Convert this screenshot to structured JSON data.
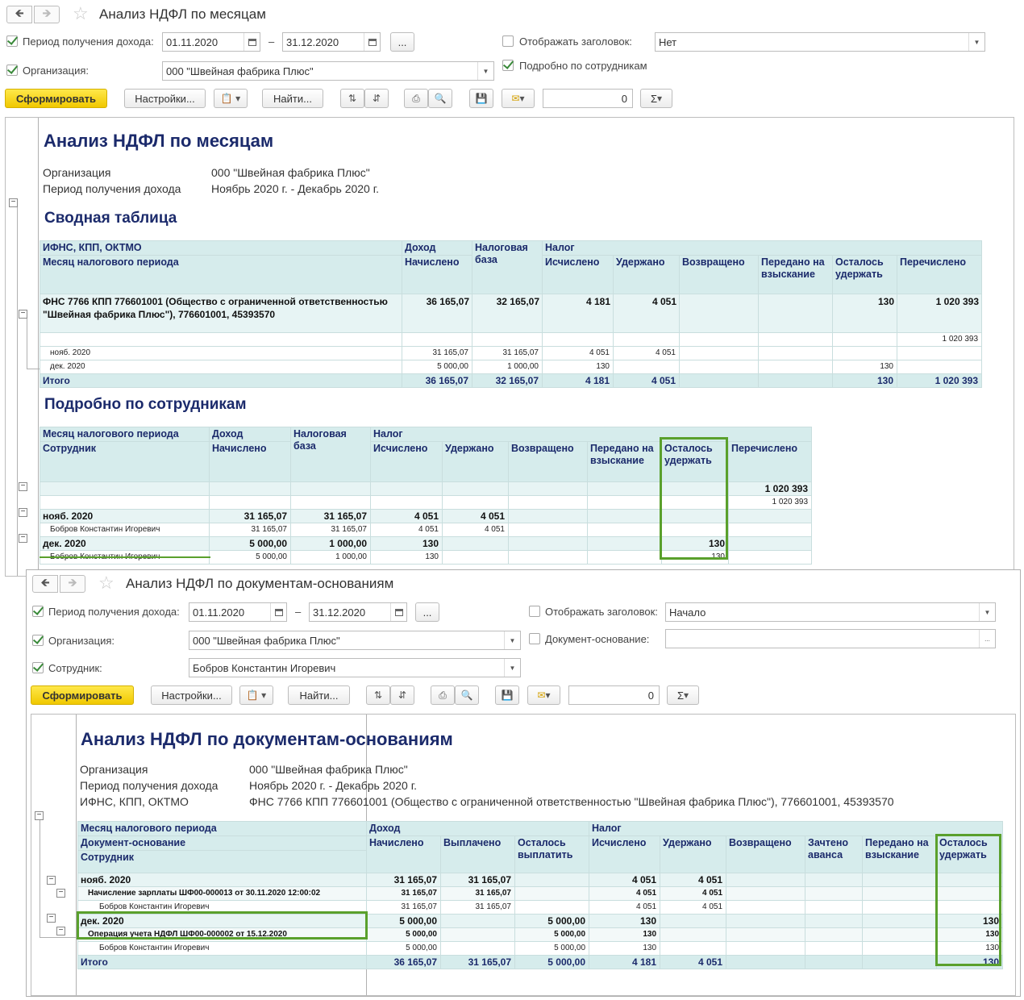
{
  "win1": {
    "title": "Анализ НДФЛ по месяцам",
    "period_label": "Период получения дохода:",
    "date_from": "01.11.2020",
    "date_sep": "–",
    "date_to": "31.12.2020",
    "dots": "...",
    "org_label": "Организация:",
    "org_value": "000 \"Швейная фабрика Плюс\"",
    "show_header_label": "Отображать заголовок:",
    "show_header_value": "Нет",
    "detail_label": "Подробно по сотрудникам",
    "btn_generate": "Сформировать",
    "btn_settings": "Настройки...",
    "btn_find": "Найти...",
    "sum_value": "0",
    "sigma": "Σ",
    "report": {
      "title": "Анализ НДФЛ по месяцам",
      "org_label": "Организация",
      "org_value": "000 \"Швейная фабрика Плюс\"",
      "period_label": "Период получения дохода",
      "period_value": "Ноябрь 2020 г. - Декабрь 2020 г.",
      "summary_title": "Сводная таблица",
      "detail_title": "Подробно по сотрудникам",
      "t1": {
        "h_ifns": "ИФНС, КПП, ОКТМО",
        "h_month": "Месяц налогового периода",
        "h_income": "Доход",
        "h_accrued": "Начислено",
        "h_base": "Налоговая база",
        "h_tax": "Налог",
        "h_calc": "Исчислено",
        "h_withheld": "Удержано",
        "h_returned": "Возвращено",
        "h_collect": "Передано на взыскание",
        "h_remain": "Осталось удержать",
        "h_transferred": "Перечислено",
        "grp": {
          "name": "ФНС 7766 КПП 776601001 (Общество с ограниченной ответственностью \"Швейная фабрика Плюс\"), 776601001, 45393570",
          "accrued": "36 165,07",
          "base": "32 165,07",
          "calc": "4 181",
          "withheld": "4 051",
          "remain": "130",
          "transferred": "1 020 393"
        },
        "row_blank_transferred": "1 020 393",
        "rows": [
          {
            "month": "нояб. 2020",
            "accrued": "31 165,07",
            "base": "31 165,07",
            "calc": "4 051",
            "withheld": "4 051",
            "remain": ""
          },
          {
            "month": "дек. 2020",
            "accrued": "5 000,00",
            "base": "1 000,00",
            "calc": "130",
            "withheld": "",
            "remain": "130"
          }
        ],
        "total": {
          "label": "Итого",
          "accrued": "36 165,07",
          "base": "32 165,07",
          "calc": "4 181",
          "withheld": "4 051",
          "remain": "130",
          "transferred": "1 020 393"
        }
      },
      "t2": {
        "h_month": "Месяц налогового периода",
        "h_employee": "Сотрудник",
        "h_income": "Доход",
        "h_accrued": "Начислено",
        "h_base": "Налоговая база",
        "h_tax": "Налог",
        "h_calc": "Исчислено",
        "h_withheld": "Удержано",
        "h_returned": "Возвращено",
        "h_collect": "Передано на взыскание",
        "h_remain": "Осталось удержать",
        "h_transferred": "Перечислено",
        "top_transferred": "1 020 393",
        "sub_transferred": "1 020 393",
        "nov": {
          "month": "нояб. 2020",
          "accrued": "31 165,07",
          "base": "31 165,07",
          "calc": "4 051",
          "withheld": "4 051"
        },
        "nov_emp": {
          "name": "Бобров Константин Игоревич",
          "accrued": "31 165,07",
          "base": "31 165,07",
          "calc": "4 051",
          "withheld": "4 051"
        },
        "dec": {
          "month": "дек. 2020",
          "accrued": "5 000,00",
          "base": "1 000,00",
          "calc": "130",
          "remain": "130"
        },
        "dec_emp": {
          "name": "Бобров Константин Игоревич",
          "accrued": "5 000,00",
          "base": "1 000,00",
          "calc": "130",
          "remain": "130"
        }
      }
    }
  },
  "win2": {
    "title": "Анализ НДФЛ по документам-основаниям",
    "period_label": "Период получения дохода:",
    "date_from": "01.11.2020",
    "date_sep": "–",
    "date_to": "31.12.2020",
    "dots": "...",
    "org_label": "Организация:",
    "org_value": "000 \"Швейная фабрика Плюс\"",
    "emp_label": "Сотрудник:",
    "emp_value": "Бобров Константин Игоревич",
    "show_header_label": "Отображать заголовок:",
    "show_header_value": "Начало",
    "doc_label": "Документ-основание:",
    "doc_value": "",
    "btn_generate": "Сформировать",
    "btn_settings": "Настройки...",
    "btn_find": "Найти...",
    "sum_value": "0",
    "sigma": "Σ",
    "report": {
      "title": "Анализ НДФЛ по документам-основаниям",
      "org_label": "Организация",
      "org_value": "000 \"Швейная фабрика Плюс\"",
      "period_label": "Период получения дохода",
      "period_value": "Ноябрь 2020 г. - Декабрь 2020 г.",
      "ifns_label": "ИФНС, КПП, ОКТМО",
      "ifns_value": "ФНС 7766 КПП 776601001 (Общество с ограниченной ответственностью \"Швейная фабрика Плюс\"), 776601001, 45393570",
      "h_month": "Месяц налогового периода",
      "h_doc": "Документ-основание",
      "h_employee": "Сотрудник",
      "h_income": "Доход",
      "h_accrued": "Начислено",
      "h_paid": "Выплачено",
      "h_remain_pay": "Осталось выплатить",
      "h_tax": "Налог",
      "h_calc": "Исчислено",
      "h_withheld": "Удержано",
      "h_returned": "Возвращено",
      "h_offset": "Зачтено аванса",
      "h_collect": "Передано на взыскание",
      "h_remain": "Осталось удержать",
      "nov": {
        "label": "нояб. 2020",
        "accrued": "31 165,07",
        "paid": "31 165,07",
        "calc": "4 051",
        "withheld": "4 051"
      },
      "nov_doc": {
        "label": "Начисление зарплаты ШФ00-000013 от 30.11.2020 12:00:02",
        "accrued": "31 165,07",
        "paid": "31 165,07",
        "calc": "4 051",
        "withheld": "4 051"
      },
      "nov_emp": {
        "label": "Бобров Константин Игоревич",
        "accrued": "31 165,07",
        "paid": "31 165,07",
        "calc": "4 051",
        "withheld": "4 051"
      },
      "dec": {
        "label": "дек. 2020",
        "accrued": "5 000,00",
        "remain_pay": "5 000,00",
        "calc": "130",
        "remain": "130"
      },
      "dec_doc": {
        "label": "Операция учета НДФЛ ШФ00-000002 от 15.12.2020",
        "accrued": "5 000,00",
        "remain_pay": "5 000,00",
        "calc": "130",
        "remain": "130"
      },
      "dec_emp": {
        "label": "Бобров Константин Игоревич",
        "accrued": "5 000,00",
        "remain_pay": "5 000,00",
        "calc": "130",
        "remain": "130"
      },
      "total": {
        "label": "Итого",
        "accrued": "36 165,07",
        "paid": "31 165,07",
        "remain_pay": "5 000,00",
        "calc": "4 181",
        "withheld": "4 051",
        "remain": "130"
      }
    }
  },
  "colors": {
    "accent": "#f0c800",
    "heading": "#1b2a6b",
    "header_bg": "#d6ecec",
    "highlight": "#5aa02c"
  }
}
